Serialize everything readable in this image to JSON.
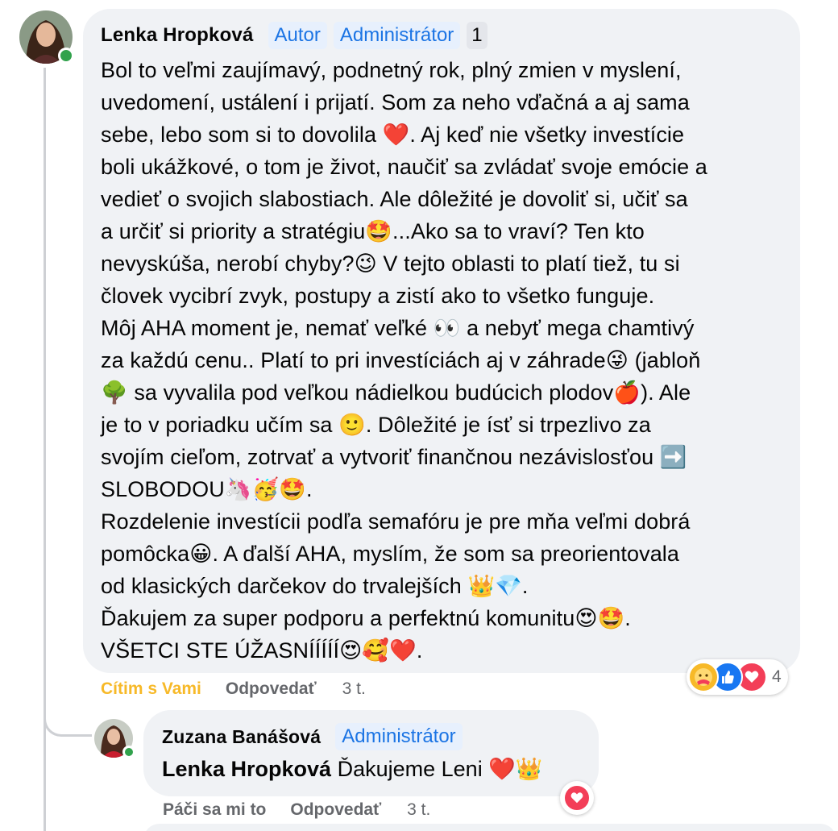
{
  "comment": {
    "author": "Lenka Hropková",
    "badges": [
      "Autor",
      "Administrátor"
    ],
    "badge_count": "1",
    "text": "Bol to veľmi zaujímavý, podnetný rok, plný zmien v myslení,\nuvedomení, ustálení i prijatí. Som za neho vďačná a aj sama\nsebe, lebo som si to dovolila ❤️. Aj keď nie všetky investície\nboli ukážkové, o tom je život, naučiť sa zvládať svoje emócie a\nvedieť o svojich slabostiach. Ale dôležité je dovoliť si, učiť sa\na určiť si priority a stratégiu🤩...Ako sa to vraví? Ten kto\nnevyskúša, nerobí chyby?😉 V tejto oblasti to platí tiež, tu si\nčlovek vycibrí zvyk, postupy a zistí ako to všetko funguje.\nMôj AHA moment je, nemať veľké 👀 a nebyť mega chamtivý\nza každú cenu.. Platí to pri investíciách aj v záhrade😜 (jabloň\n🌳 sa vyvalila pod veľkou nádielkou budúcich plodov🍎). Ale\nje to v poriadku učím sa 🙂. Dôležité je ísť si trpezlivo za\nsvojím cieľom, zotrvať a vytvoriť finančnou nezávislosťou ➡️\nSLOBODOU🦄🥳🤩.\nRozdelenie investícii podľa semafóru je pre mňa veľmi dobrá\npomôcka😀. A ďalší AHA, myslím, že som sa preorientovala\nod klasických darčekov do trvalejších 👑💎.\nĎakujem za super podporu a perfektnú komunitu😍🤩.\nVŠETCI STE ÚŽASNÍÍÍÍÍ😍🥰❤️.",
    "actions": {
      "care": "Cítim s Vami",
      "reply": "Odpovedať",
      "time": "3 t."
    },
    "reactions": {
      "icons": [
        "care-icon",
        "like-icon",
        "love-icon"
      ],
      "count": "4"
    },
    "colors": {
      "care": "#f7b928",
      "like": "#1877f2",
      "love": "#f33e58",
      "badge_text": "#1b74e4",
      "online": "#31a24c"
    }
  },
  "reply": {
    "author": "Zuzana Banášová",
    "badge": "Administrátor",
    "mention": "Lenka Hropková",
    "text": "Ďakujeme Leni ❤️👑",
    "actions": {
      "like": "Páči sa mi to",
      "reply": "Odpovedať",
      "time": "3 t."
    },
    "reactions": {
      "icons": [
        "love-icon"
      ]
    }
  }
}
